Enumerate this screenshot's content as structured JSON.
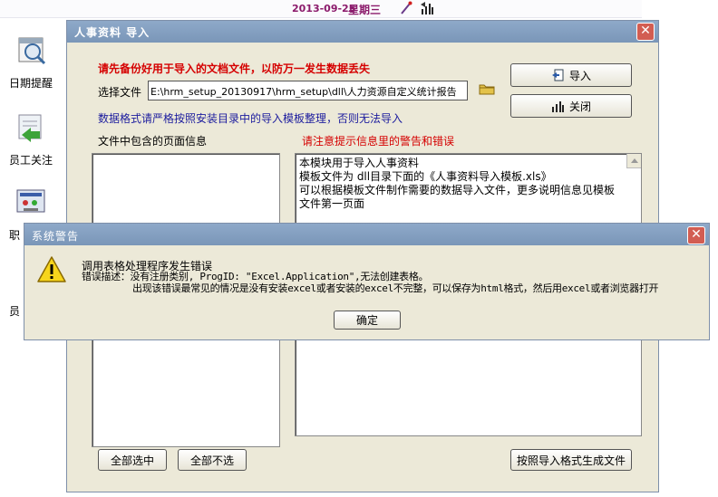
{
  "topbar": {
    "date": "2013-09-25",
    "weekday": "星期三"
  },
  "nav": {
    "items": [
      {
        "label": "日期提醒",
        "icon": "date-reminder-icon"
      },
      {
        "label": "员工关注",
        "icon": "employee-focus-icon"
      },
      {
        "label": "职",
        "icon": "position-icon"
      },
      {
        "label": "员",
        "icon": "employee-icon"
      }
    ]
  },
  "import_dialog": {
    "title": "人事资料  导入",
    "backup_warning": "请先备份好用于导入的文档文件，以防万一发生数据丢失",
    "file_label": "选择文件",
    "file_path": "E:\\hrm_setup_20130917\\hrm_setup\\dll\\人力资源自定义统计报告",
    "format_notice": "数据格式请严格按照安装目录中的导入模板整理，否则无法导入",
    "pages_label": "文件中包含的页面信息",
    "messages_label": "请注意提示信息里的警告和错误",
    "import_button": "导入",
    "close_button": "关闭",
    "info_lines": [
      "本模块用于导入人事资料",
      "模板文件为 dll目录下面的《人事资料导入模板.xls》",
      "可以根据模板文件制作需要的数据导入文件，更多说明信息见模板",
      "文件第一页面"
    ],
    "select_all_button": "全部选中",
    "deselect_all_button": "全部不选",
    "generate_button": "按照导入格式生成文件"
  },
  "alert_dialog": {
    "title": "系统警告",
    "heading": "调用表格处理程序发生错误",
    "detail": "错误描述：没有注册类别, ProgID: \"Excel.Application\",无法创建表格。",
    "explanation": "出现该错误最常见的情况是没有安装excel或者安装的excel不完整，可以保存为html格式，然后用excel或者浏览器打开",
    "ok_button": "确定"
  },
  "colors": {
    "titlebar": "#7f9bbd",
    "window_bg": "#ece9d8",
    "warning_red": "#d50000",
    "notice_blue": "#1c1c9e",
    "date_purple": "#8b1a6b",
    "close_red": "#d25d52"
  }
}
